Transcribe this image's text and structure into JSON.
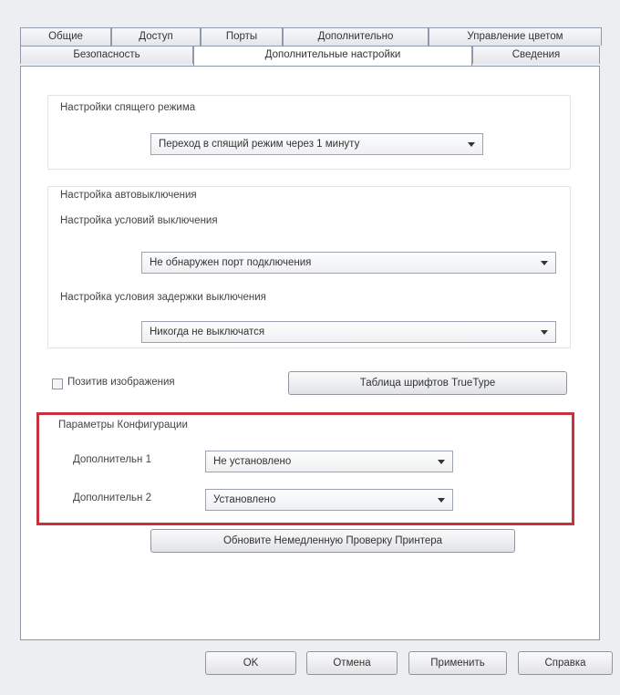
{
  "tabs_row1": [
    {
      "label": "Общие"
    },
    {
      "label": "Доступ"
    },
    {
      "label": "Порты"
    },
    {
      "label": "Дополнительно"
    },
    {
      "label": "Управление цветом"
    }
  ],
  "tabs_row2": [
    {
      "label": "Безопасность"
    },
    {
      "label": "Дополнительные настройки",
      "active": true
    },
    {
      "label": "Сведения"
    }
  ],
  "sleep": {
    "group_label": "Настройки спящего режима",
    "combo_value": "Переход в спящий режим через 1 минуту"
  },
  "autooff": {
    "group_label": "Настройка автовыключения",
    "condition_label": "Настройка условий выключения",
    "condition_value": "Не обнаружен порт подключения",
    "delay_label": "Настройка условия задержки выключения",
    "delay_value": "Никогда не выключатся"
  },
  "positive_image_label": "Позитив изображения",
  "truetype_button_label": "Таблица шрифтов TrueType",
  "config": {
    "group_label": "Параметры Конфигурации",
    "option1_label": "Дополнительн 1",
    "option1_value": "Не установлено",
    "option2_label": "Дополнительн 2",
    "option2_value": "Установлено",
    "update_button_label": "Обновите Немедленную Проверку Принтера"
  },
  "buttons": {
    "ok": "OK",
    "cancel": "Отмена",
    "apply": "Применить",
    "help": "Справка"
  },
  "colors": {
    "highlight": "#c8303b"
  }
}
